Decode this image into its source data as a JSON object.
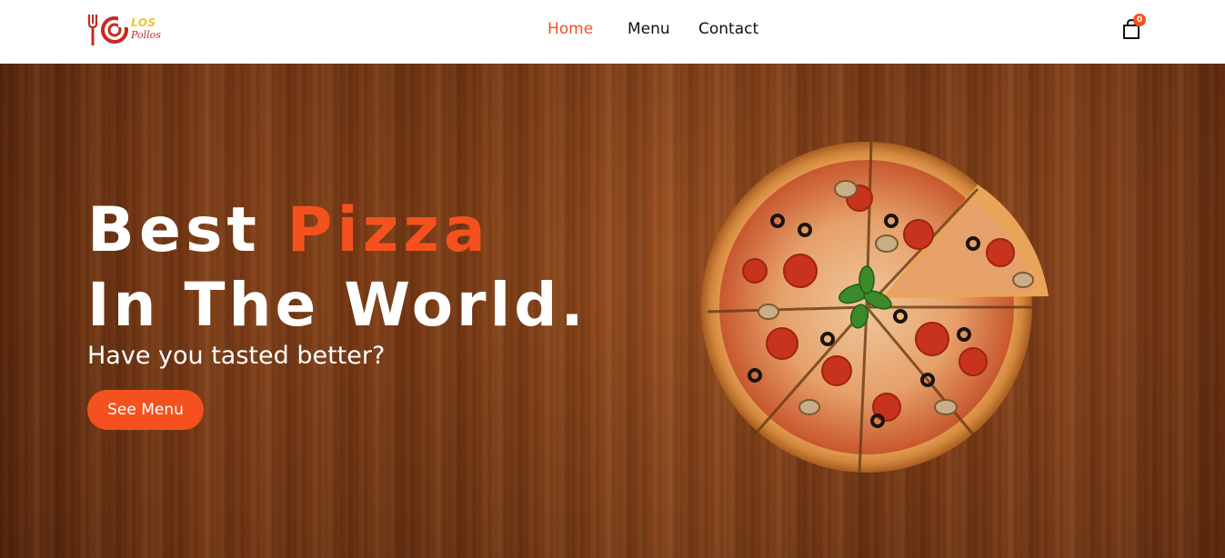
{
  "brand": {
    "name_top": "LOS",
    "name_bottom": "Pollos",
    "colors": {
      "red": "#c92a1f",
      "yellow": "#f2c230"
    }
  },
  "nav": {
    "items": [
      {
        "label": "Home",
        "active": true
      },
      {
        "label": "Menu",
        "active": false
      },
      {
        "label": "Contact",
        "active": false
      }
    ]
  },
  "cart": {
    "icon": "shopping-bag-icon",
    "count": "0"
  },
  "hero": {
    "headline_word_1": "Best",
    "headline_accent": "Pizza",
    "headline_line_2": "In The World.",
    "subtitle": "Have you tasted better?",
    "cta_label": "See Menu",
    "image": "sliced-pizza-image"
  },
  "colors": {
    "accent": "#f4511e",
    "text": "#111111",
    "wood": "#7a3812"
  }
}
